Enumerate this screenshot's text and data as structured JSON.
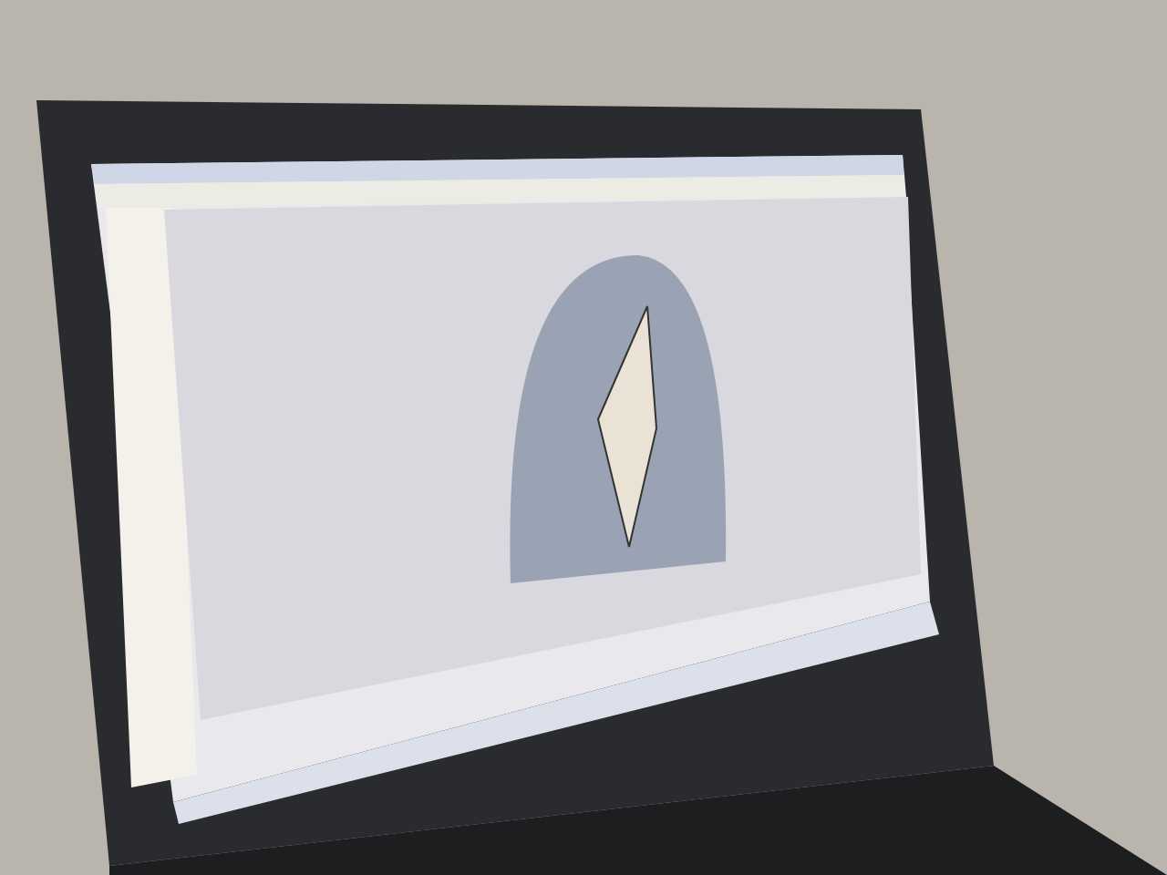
{
  "photo": {
    "kind": "laptop"
  }
}
